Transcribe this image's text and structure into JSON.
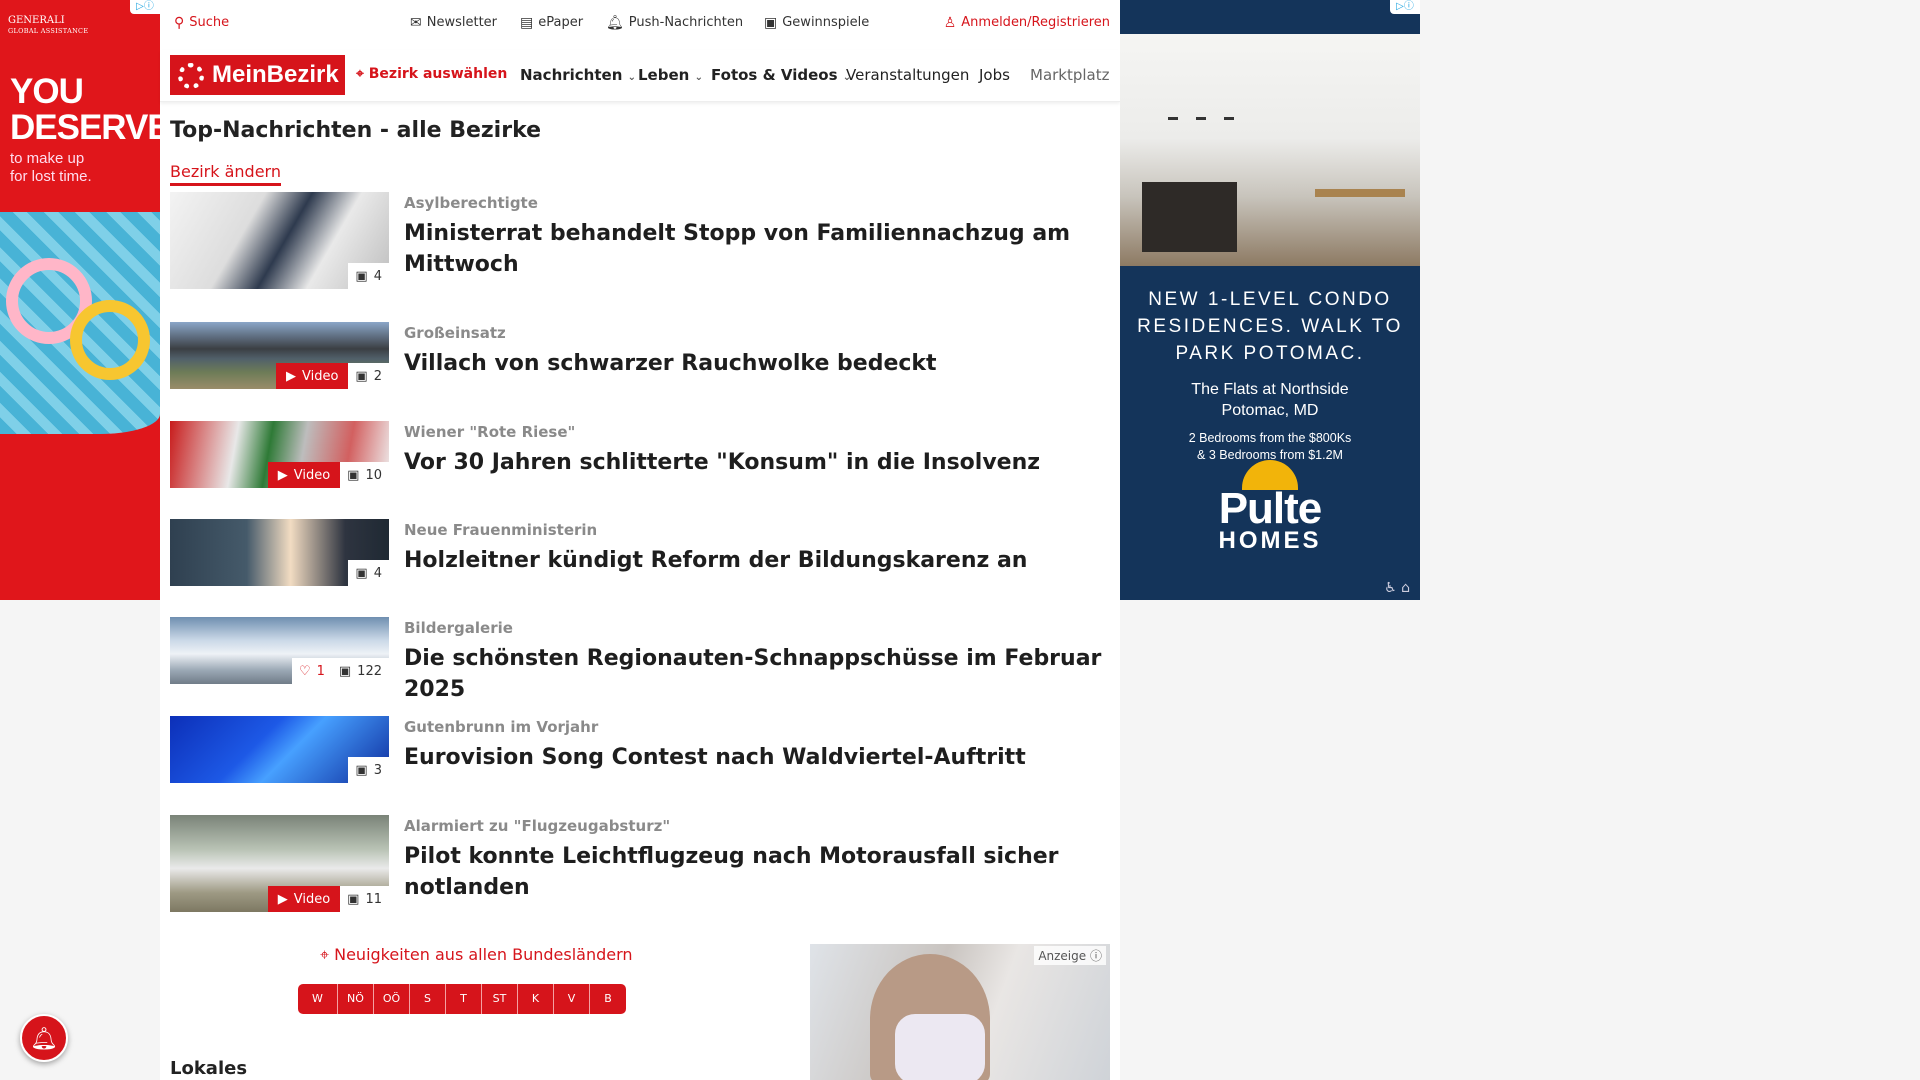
{
  "topbar": {
    "search": "Suche",
    "newsletter": "Newsletter",
    "epaper": "ePaper",
    "push": "Push-Nachrichten",
    "games": "Gewinnspiele",
    "login": "Anmelden/Registrieren"
  },
  "nav": {
    "logo": "MeinBezirk",
    "bezirk": "Bezirk auswählen",
    "items": [
      "Nachrichten",
      "Leben",
      "Fotos & Videos",
      "Veranstaltungen",
      "Jobs",
      "Marktplatz"
    ]
  },
  "main": {
    "title": "Top-Nachrichten - alle Bezirke",
    "change_bezirk": "Bezirk ändern"
  },
  "articles": [
    {
      "kicker": "Asylberechtigte",
      "headline": "Ministerrat behandelt Stopp von Familiennachzug am Mittwoch",
      "photos": "4",
      "video": null,
      "likes": null
    },
    {
      "kicker": "Großeinsatz",
      "headline": "Villach von schwarzer Rauchwolke bedeckt",
      "photos": "2",
      "video": "Video",
      "likes": null
    },
    {
      "kicker": "Wiener \"Rote Riese\"",
      "headline": "Vor 30 Jahren schlitterte \"Konsum\" in die Insolvenz",
      "photos": "10",
      "video": "Video",
      "likes": null
    },
    {
      "kicker": "Neue Frauenministerin",
      "headline": "Holzleitner kündigt Reform der Bildungskarenz an",
      "photos": "4",
      "video": null,
      "likes": null
    },
    {
      "kicker": "Bildergalerie",
      "headline": "Die schönsten Regionauten-Schnappschüsse im Februar 2025",
      "photos": "122",
      "video": null,
      "likes": "1"
    },
    {
      "kicker": "Gutenbrunn im Vorjahr",
      "headline": "Eurovision Song Contest nach Waldviertel-Auftritt",
      "photos": "3",
      "video": null,
      "likes": null
    },
    {
      "kicker": "Alarmiert zu \"Flugzeugabsturz\"",
      "headline": "Pilot konnte Leichtflugzeug nach Motorausfall sicher notlanden",
      "photos": "11",
      "video": "Video",
      "likes": null
    }
  ],
  "bundeslaender": {
    "label": "Neuigkeiten aus allen Bundesländern",
    "states": [
      "W",
      "NÖ",
      "OÖ",
      "S",
      "T",
      "ST",
      "K",
      "V",
      "B"
    ]
  },
  "lokales": "Lokales",
  "ads": {
    "inline_label": "Anzeige",
    "left": {
      "brand": "GENERALI",
      "brand_sub": "GLOBAL ASSISTANCE",
      "headline_1": "YOU",
      "headline_2": "DESERVE",
      "sub_1": "to make up",
      "sub_2": "for lost time."
    },
    "right": {
      "headline": "NEW 1-LEVEL CONDO RESIDENCES. WALK TO PARK POTOMAC.",
      "place_1": "The Flats at Northside",
      "place_2": "Potomac, MD",
      "price_1": "2 Bedrooms from the $800Ks",
      "price_2": "& 3 Bedrooms from $1.2M",
      "logo_1": "Pulte",
      "logo_2": "HOMES"
    }
  },
  "colors": {
    "brand_red": "#d6141b",
    "ad_navy": "#14345a"
  }
}
